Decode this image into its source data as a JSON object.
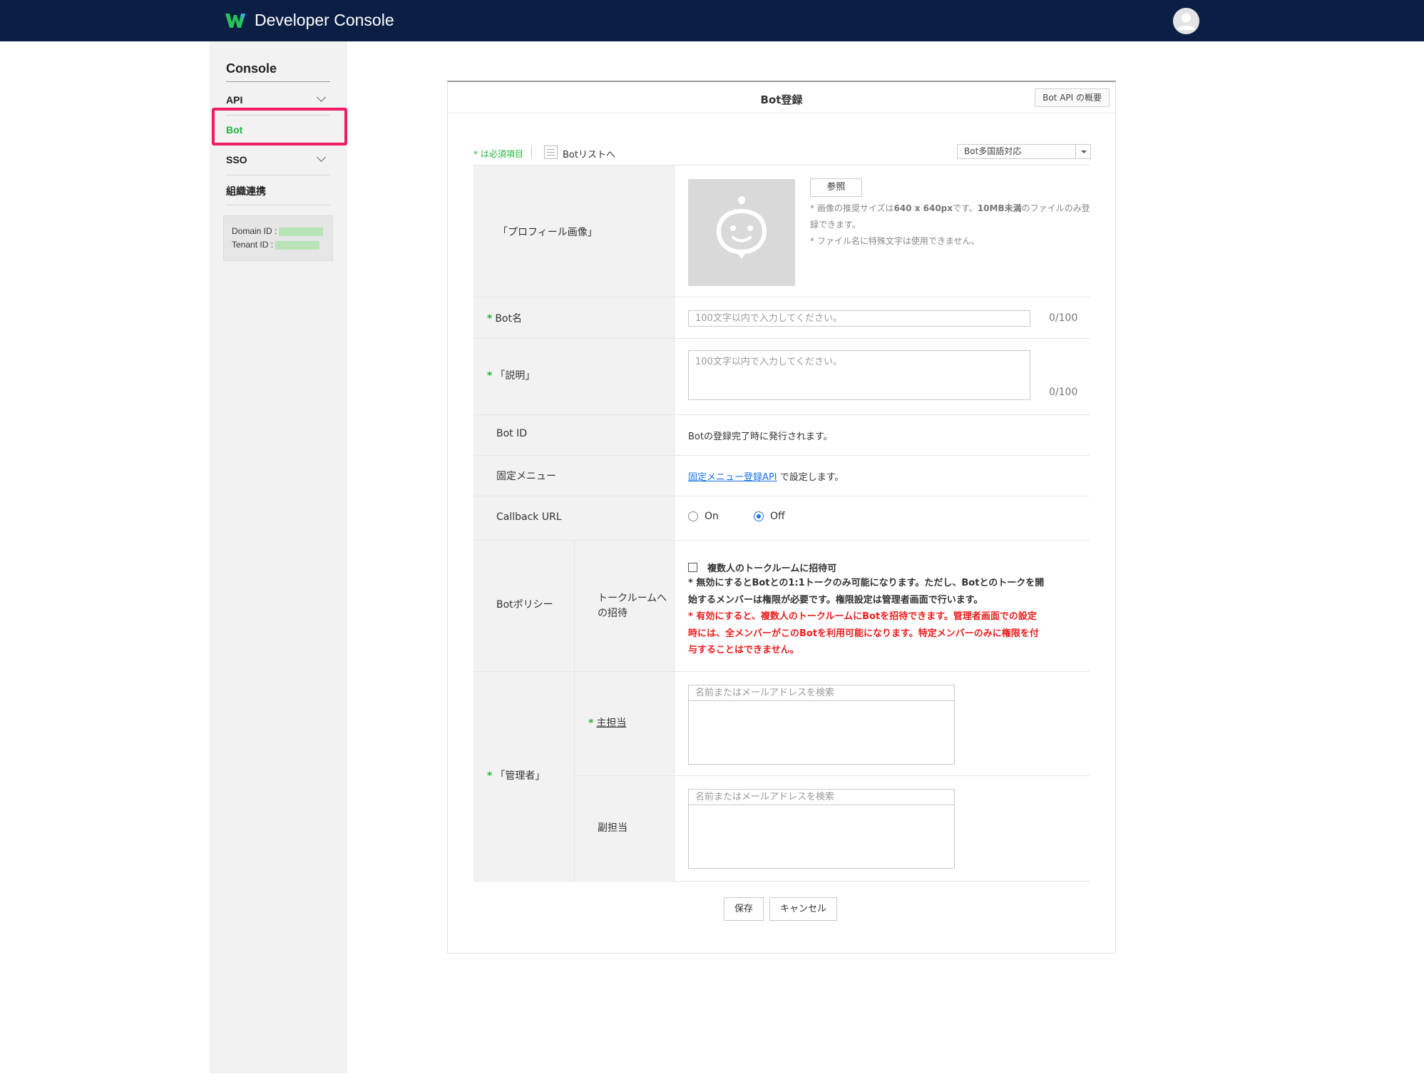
{
  "header": {
    "app_title": "Developer Console"
  },
  "sidebar": {
    "title": "Console",
    "items": [
      {
        "label": "API"
      },
      {
        "label": "Bot"
      },
      {
        "label": "SSO"
      },
      {
        "label": "組織連携"
      }
    ],
    "domain_id_label": "Domain ID :",
    "tenant_id_label": "Tenant ID :"
  },
  "panel": {
    "title": "Bot登録",
    "overview_button": "Bot API の概要",
    "required_note": "* は必須項目",
    "list_link": "Botリストへ",
    "lang_select": "Bot多国語対応"
  },
  "form": {
    "profile": {
      "label": "「プロフィール画像」",
      "button": "参照",
      "note1_pre": "* 画像の推奨サイズは",
      "note1_size": "640 x 640px",
      "note1_mid": "です。",
      "note1_limit": "10MB未満",
      "note1_post": "のファイルのみ登録できます。",
      "note2": "* ファイル名に特殊文字は使用できません。"
    },
    "bot_name": {
      "label": "Bot名",
      "placeholder": "100文字以内で入力してください。",
      "counter": "0/100"
    },
    "description": {
      "label": "「説明」",
      "placeholder": "100文字以内で入力してください。",
      "counter": "0/100"
    },
    "bot_id": {
      "label": "Bot ID",
      "value": "Botの登録完了時に発行されます。"
    },
    "fixed_menu": {
      "label": "固定メニュー",
      "link": "固定メニュー登録API",
      "suffix": " で設定します。"
    },
    "callback": {
      "label": "Callback URL",
      "on_label": "On",
      "off_label": "Off",
      "selected": "Off"
    },
    "policy": {
      "label": "Botポリシー",
      "sub_label_1": "トークルームへ",
      "sub_label_2": "の招待",
      "checkbox_label": "複数人のトークルームに招待可",
      "note_black_1": "* 無効にするとBotとの1:1トークのみ可能になります。ただし、Botとのトークを開",
      "note_black_2": "始するメンバーは権限が必要です。権限設定は管理者画面で行います。",
      "note_red_1": "* 有効にすると、複数人のトークルームにBotを招待できます。管理者画面での設定",
      "note_red_2": "時には、全メンバーがこのBotを利用可能になります。特定メンバーのみに権限を付",
      "note_red_3": "与することはできません。"
    },
    "admin": {
      "label": "「管理者」",
      "main_label": "主担当",
      "sub_label": "副担当",
      "search_placeholder": "名前またはメールアドレスを検索"
    }
  },
  "footer": {
    "save": "保存",
    "cancel": "キャンセル"
  },
  "colors": {
    "topbar": "#0b1f44",
    "accent_green": "#1fb53a",
    "highlight": "#ef1c64",
    "link": "#1a73e8",
    "warning_red": "#ef1c1c"
  }
}
